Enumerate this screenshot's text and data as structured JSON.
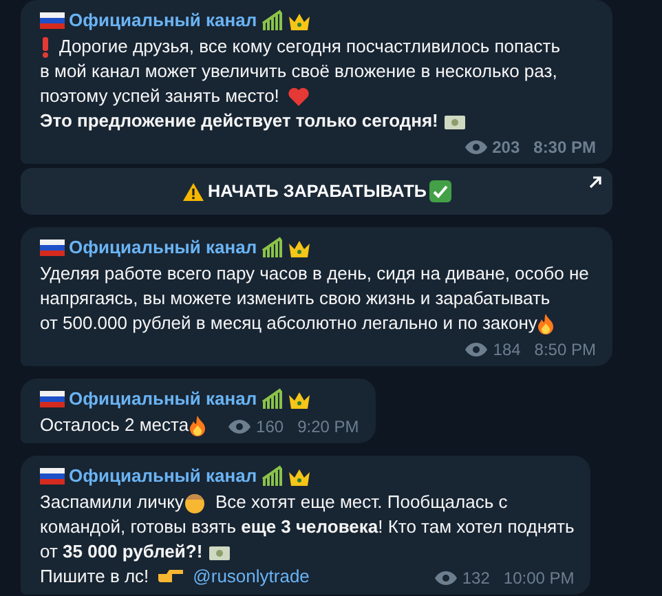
{
  "messages": [
    {
      "author": "Официальный канал",
      "lines": [
        {
          "bold": false,
          "segments": [
            "Дорогие друзья, все кому сегодня посчастливилось попасть"
          ]
        },
        {
          "bold": false,
          "segments": [
            "в мой канал может увеличить своё вложение в несколько раз,"
          ]
        },
        {
          "bold": false,
          "segments": [
            "поэтому успей занять место!"
          ]
        },
        {
          "bold": true,
          "segments": [
            "Это предложение действует только сегодня!"
          ]
        }
      ],
      "views": "203",
      "time": "8:30 PM",
      "button": "НАЧАТЬ ЗАРАБАТЫВАТЬ"
    },
    {
      "author": "Официальный канал",
      "lines": [
        {
          "bold": false,
          "segments": [
            "Уделяя работе всего пару часов в день, сидя на диване, особо не"
          ]
        },
        {
          "bold": false,
          "segments": [
            "напрягаясь, вы можете изменить свою жизнь и зарабатывать"
          ]
        },
        {
          "bold": false,
          "segments": [
            "от 500.000 рублей в месяц абсолютно легально и по закону"
          ]
        }
      ],
      "views": "184",
      "time": "8:50 PM"
    },
    {
      "author": "Официальный канал",
      "lines": [
        {
          "bold": false,
          "segments": [
            "Осталось 2 места"
          ]
        }
      ],
      "views": "160",
      "time": "9:20 PM"
    },
    {
      "author": "Официальный канал",
      "lines": [
        {
          "bold": false,
          "segments": [
            "Заспамили личку",
            "Все хотят еще мест. Пообщалась с"
          ]
        },
        {
          "bold": false,
          "segments": [
            "командой, готовы взять **еще 3 человека**! Кто там хотел поднять"
          ]
        },
        {
          "bold": false,
          "segments": [
            "от **35 000 рублей?!**"
          ]
        },
        {
          "bold": false,
          "segments": [
            "Пишите в лс!"
          ],
          "link": "@rusonlytrade"
        }
      ],
      "views": "132",
      "time": "10:00 PM"
    }
  ]
}
